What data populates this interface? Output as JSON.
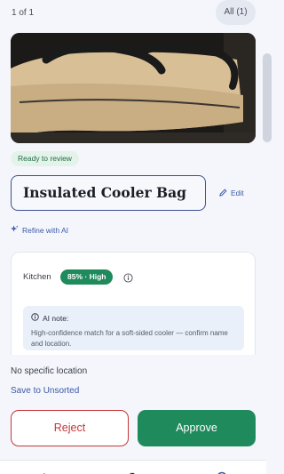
{
  "header": {
    "counter": "1 of 1",
    "filter_label": "All (1)"
  },
  "item": {
    "status": "Ready to review",
    "name": "Insulated Cooler Bag",
    "edit_label": "Edit",
    "refine_label": "Refine with AI"
  },
  "suggestion": {
    "room": "Kitchen",
    "confidence": "85% · High",
    "ai_note_title": "AI note:",
    "ai_note_text": "High-confidence match for a soft-sided cooler — confirm name and location."
  },
  "location": {
    "text": "No specific location",
    "save_link": "Save to Unsorted"
  },
  "actions": {
    "reject": "Reject",
    "approve": "Approve"
  },
  "colors": {
    "accent": "#3c58a8",
    "approve": "#1f8a5c",
    "reject": "#c6363a"
  },
  "icons": {
    "edit": "pencil-icon",
    "refine": "sparkle-icon",
    "info": "info-icon",
    "nav": [
      "home-icon",
      "search-icon",
      "check-circle-icon"
    ]
  }
}
